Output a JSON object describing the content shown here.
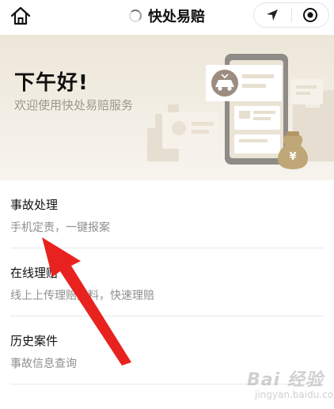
{
  "navbar": {
    "title": "快处易赔"
  },
  "banner": {
    "greeting": "下午好!",
    "welcome": "欢迎使用快处易赔服务",
    "money_bag_symbol": "¥"
  },
  "list": {
    "items": [
      {
        "title": "事故处理",
        "subtitle": "手机定责，一键报案"
      },
      {
        "title": "在线理赔",
        "subtitle": "线上上传理赔资料，快速理赔"
      },
      {
        "title": "历史案件",
        "subtitle": "事故信息查询"
      }
    ]
  },
  "watermark": {
    "logo_text": "Bai 经验",
    "url": "jingyan.baidu.com"
  },
  "colors": {
    "arrow": "#e8231f",
    "banner_bg": "#efe9dd",
    "subtext": "#8f8f8f"
  },
  "icons": {
    "home": "home-icon",
    "location": "location-arrow-icon",
    "close": "close-target-icon",
    "loading": "loading-spinner-icon"
  }
}
